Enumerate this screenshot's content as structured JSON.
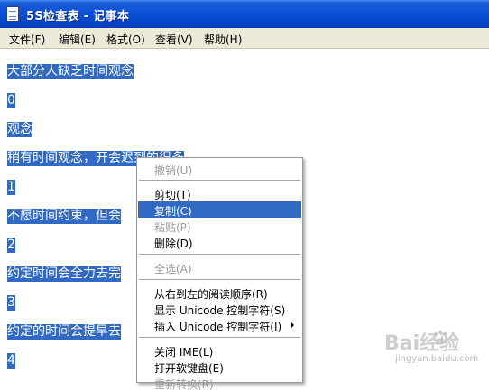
{
  "window": {
    "title": "5S检查表 - 记事本",
    "icon": "notepad-icon"
  },
  "menubar": {
    "items": [
      "文件(F)",
      "编辑(E)",
      "格式(O)",
      "查看(V)",
      "帮助(H)"
    ]
  },
  "editor": {
    "lines": [
      "大部分人缺乏时间观念",
      "0",
      "观念",
      "稍有时间观念，开会迟到的很多",
      "1",
      "不愿时间约束，但会",
      "2",
      "约定时间会全力去完",
      "3",
      "约定的时间会提早去",
      "4"
    ],
    "selection_color": "#316ac5"
  },
  "context_menu": {
    "items": [
      {
        "label": "撤销(U)",
        "disabled": true
      },
      {
        "label": "剪切(T)",
        "disabled": false
      },
      {
        "label": "复制(C)",
        "disabled": false,
        "highlighted": true
      },
      {
        "label": "粘贴(P)",
        "disabled": true
      },
      {
        "label": "删除(D)",
        "disabled": false
      },
      {
        "label": "全选(A)",
        "disabled": true
      },
      {
        "label": "从右到左的阅读顺序(R)",
        "disabled": false
      },
      {
        "label": "显示 Unicode 控制字符(S)",
        "disabled": false
      },
      {
        "label": "插入 Unicode 控制字符(I)",
        "disabled": false,
        "submenu": true
      },
      {
        "label": "关闭 IME(L)",
        "disabled": false
      },
      {
        "label": "打开软键盘(E)",
        "disabled": false
      },
      {
        "label": "重新转换(R)",
        "disabled": true
      }
    ]
  },
  "watermark": {
    "text": "Bai经验",
    "sub": "jingyan.baidu.com"
  }
}
